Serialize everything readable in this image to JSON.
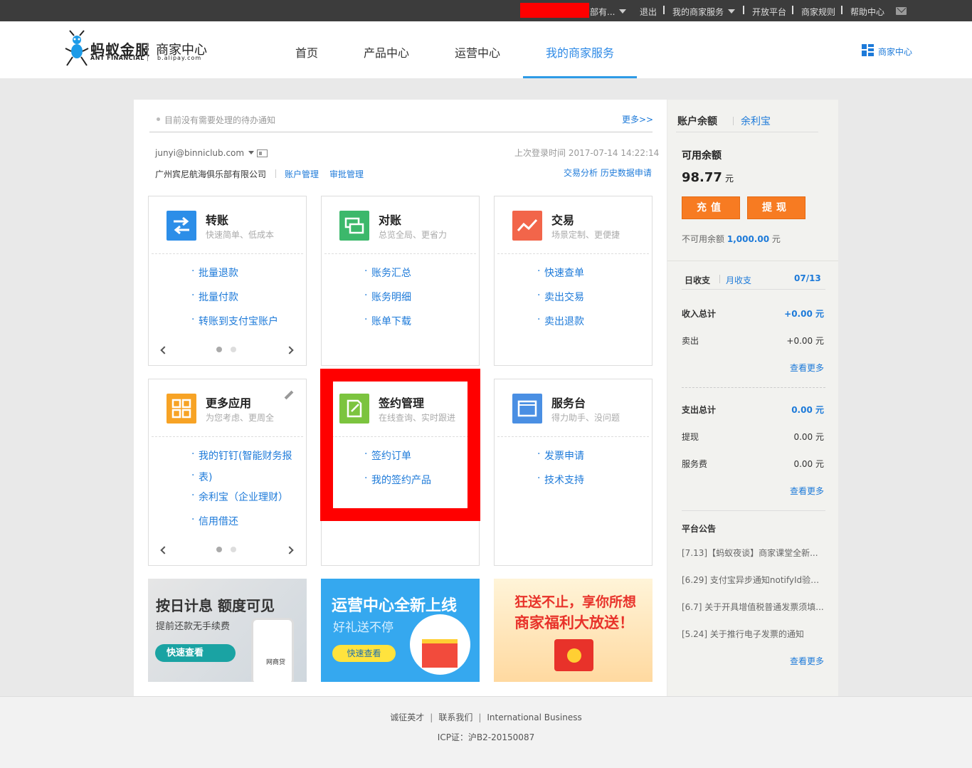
{
  "topbar": {
    "account": "部有...",
    "logout": "退出",
    "my_service": "我的商家服务",
    "open_platform": "开放平台",
    "rules": "商家规则",
    "help": "帮助中心"
  },
  "header": {
    "logo_main": "蚂蚁金服",
    "logo_sub": "ANT FINANCIAL",
    "logo_merchant": "商家中心",
    "logo_url": "b.alipay.com",
    "nav": [
      "首页",
      "产品中心",
      "运营中心",
      "我的商家服务"
    ],
    "merchant_center": "商家中心"
  },
  "main": {
    "notice": "目前没有需要处理的待办通知",
    "more": "更多>>",
    "email": "junyi@binniclub.com",
    "last_login": "上次登录时间 2017-07-14 14:22:14",
    "company": "广州宾尼航海俱乐部有限公司",
    "account_manage": "账户管理",
    "approval_manage": "审批管理",
    "trade_analysis": "交易分析",
    "history_apply": "历史数据申请"
  },
  "cards": [
    {
      "title": "转账",
      "sub": "快速简单、低成本",
      "links": [
        "批量退款",
        "批量付款",
        "转账到支付宝账户"
      ],
      "color": "#2c8ee8"
    },
    {
      "title": "对账",
      "sub": "总览全局、更省力",
      "links": [
        "账务汇总",
        "账务明细",
        "账单下载"
      ],
      "color": "#3cb86b"
    },
    {
      "title": "交易",
      "sub": "场景定制、更便捷",
      "links": [
        "快速查单",
        "卖出交易",
        "卖出退款"
      ],
      "color": "#f2654a"
    },
    {
      "title": "更多应用",
      "sub": "为您考虑、更周全",
      "links": [
        "我的钉钉(智能财务报",
        "表)",
        "余利宝（企业理财）",
        "信用借还"
      ],
      "color": "#f7a325"
    },
    {
      "title": "签约管理",
      "sub": "在线查询、实时跟进",
      "links": [
        "签约订单",
        "我的签约产品"
      ],
      "color": "#7cc43f"
    },
    {
      "title": "服务台",
      "sub": "得力助手、没问题",
      "links": [
        "发票申请",
        "技术支持"
      ],
      "color": "#4a8fe3"
    }
  ],
  "banners": [
    {
      "title": "按日计息 额度可见",
      "sub": "提前还款无手续费",
      "btn": "快速查看",
      "extra": "网商贷"
    },
    {
      "title": "运营中心全新上线",
      "sub": "好礼送不停",
      "btn": "快速查看"
    },
    {
      "title": "狂送不止，享你所想",
      "sub": "商家福利大放送！"
    }
  ],
  "sidebar": {
    "tab_balance": "账户余额",
    "tab_yulibao": "余利宝",
    "available_label": "可用余额",
    "available_value": "98.77",
    "unit": "元",
    "recharge": "充值",
    "withdraw": "提现",
    "unavailable_label": "不可用余额",
    "unavailable_value": "1,000.00",
    "daily": "日收支",
    "monthly": "月收支",
    "date": "07/13",
    "income_total_label": "收入总计",
    "income_total": "+0.00 元",
    "sell_label": "卖出",
    "sell_value": "+0.00 元",
    "see_more": "查看更多",
    "expense_total_label": "支出总计",
    "expense_total": "0.00 元",
    "withdraw_label": "提现",
    "withdraw_value": "0.00 元",
    "fee_label": "服务费",
    "fee_value": "0.00 元",
    "announce_title": "平台公告",
    "announcements": [
      "[7.13]【蚂蚁夜谈】商家课堂全新...",
      "[6.29] 支付宝异步通知notifyId验证...",
      "[6.7] 关于开具增值税普通发票须填...",
      "[5.24] 关于推行电子发票的通知"
    ]
  },
  "footer": {
    "links": [
      "诚征英才",
      "联系我们",
      "International Business"
    ],
    "icp": "ICP证：沪B2-20150087"
  }
}
